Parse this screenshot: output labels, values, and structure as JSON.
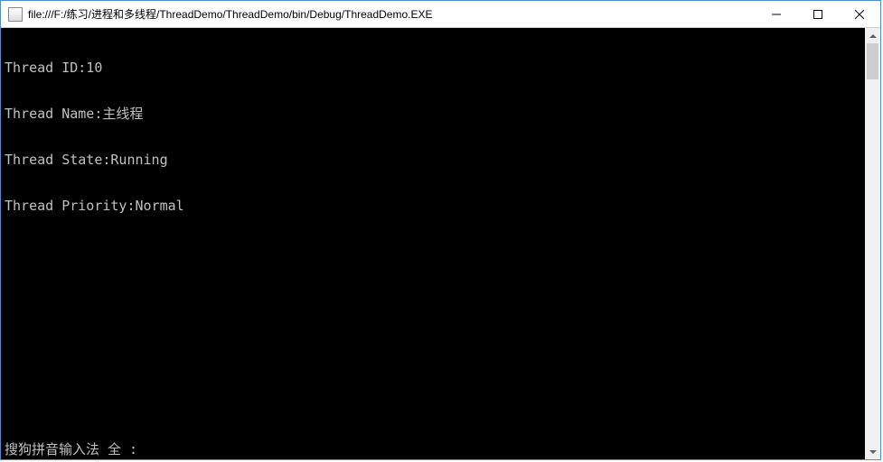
{
  "titlebar": {
    "title": "file:///F:/练习/进程和多线程/ThreadDemo/ThreadDemo/bin/Debug/ThreadDemo.EXE"
  },
  "console": {
    "lines": [
      "Thread ID:10",
      "Thread Name:主线程",
      "Thread State:Running",
      "Thread Priority:Normal"
    ],
    "ime_status": "搜狗拼音输入法 全 :"
  }
}
